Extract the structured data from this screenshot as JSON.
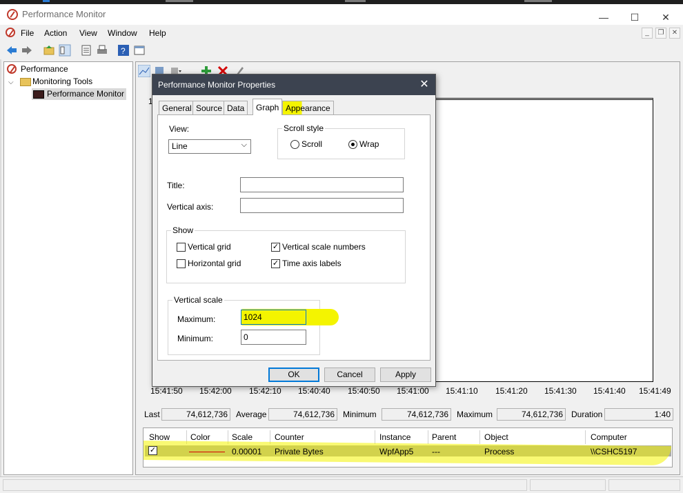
{
  "window": {
    "title": "Performance Monitor",
    "minimize": "—",
    "maximize": "☐",
    "close": "✕"
  },
  "menu": {
    "items": [
      "File",
      "Action",
      "View",
      "Window",
      "Help"
    ]
  },
  "nav": {
    "root": "Performance",
    "tools": "Monitoring Tools",
    "monitor": "Performance Monitor"
  },
  "graph": {
    "ticks": [
      "15:41:50",
      "15:42:00",
      "15:42:10",
      "15:40:40",
      "15:40:50",
      "15:41:00",
      "15:41:10",
      "15:41:20",
      "15:41:30",
      "15:41:40",
      "15:41:49"
    ],
    "axis_hint": "1"
  },
  "stats": {
    "last_label": "Last",
    "last": "74,612,736",
    "avg_label": "Average",
    "avg": "74,612,736",
    "min_label": "Minimum",
    "min": "74,612,736",
    "max_label": "Maximum",
    "max": "74,612,736",
    "dur_label": "Duration",
    "dur": "1:40"
  },
  "legend": {
    "headers": [
      "Show",
      "Color",
      "Scale",
      "Counter",
      "Instance",
      "Parent",
      "Object",
      "Computer"
    ],
    "row": {
      "show": "✓",
      "scale": "0.00001",
      "counter": "Private Bytes",
      "instance": "WpfApp5",
      "parent": "---",
      "object": "Process",
      "computer": "\\\\CSHC5197",
      "color": "#d40000"
    }
  },
  "dialog": {
    "title": "Performance Monitor Properties",
    "close": "✕",
    "tabs": [
      "General",
      "Source",
      "Data",
      "Graph",
      "Appearance"
    ],
    "active_tab": "Graph",
    "view_label": "View:",
    "view_value": "Line",
    "scroll_label": "Scroll style",
    "scroll_option": "Scroll",
    "wrap_option": "Wrap",
    "title_label": "Title:",
    "title_value": "",
    "vaxis_label": "Vertical axis:",
    "vaxis_value": "",
    "show_label": "Show",
    "vgrid": "Vertical grid",
    "hgrid": "Horizontal grid",
    "vscale_numbers": "Vertical scale numbers",
    "time_axis_labels": "Time axis labels",
    "vscale_label": "Vertical scale",
    "max_label": "Maximum:",
    "max_value": "1024",
    "min_label": "Minimum:",
    "min_value": "0",
    "ok": "OK",
    "cancel": "Cancel",
    "apply": "Apply",
    "check": "✓"
  },
  "colors": {
    "highlight": "#f4f400",
    "dialog_title": "#3c4350",
    "counter_line": "#d40000"
  }
}
